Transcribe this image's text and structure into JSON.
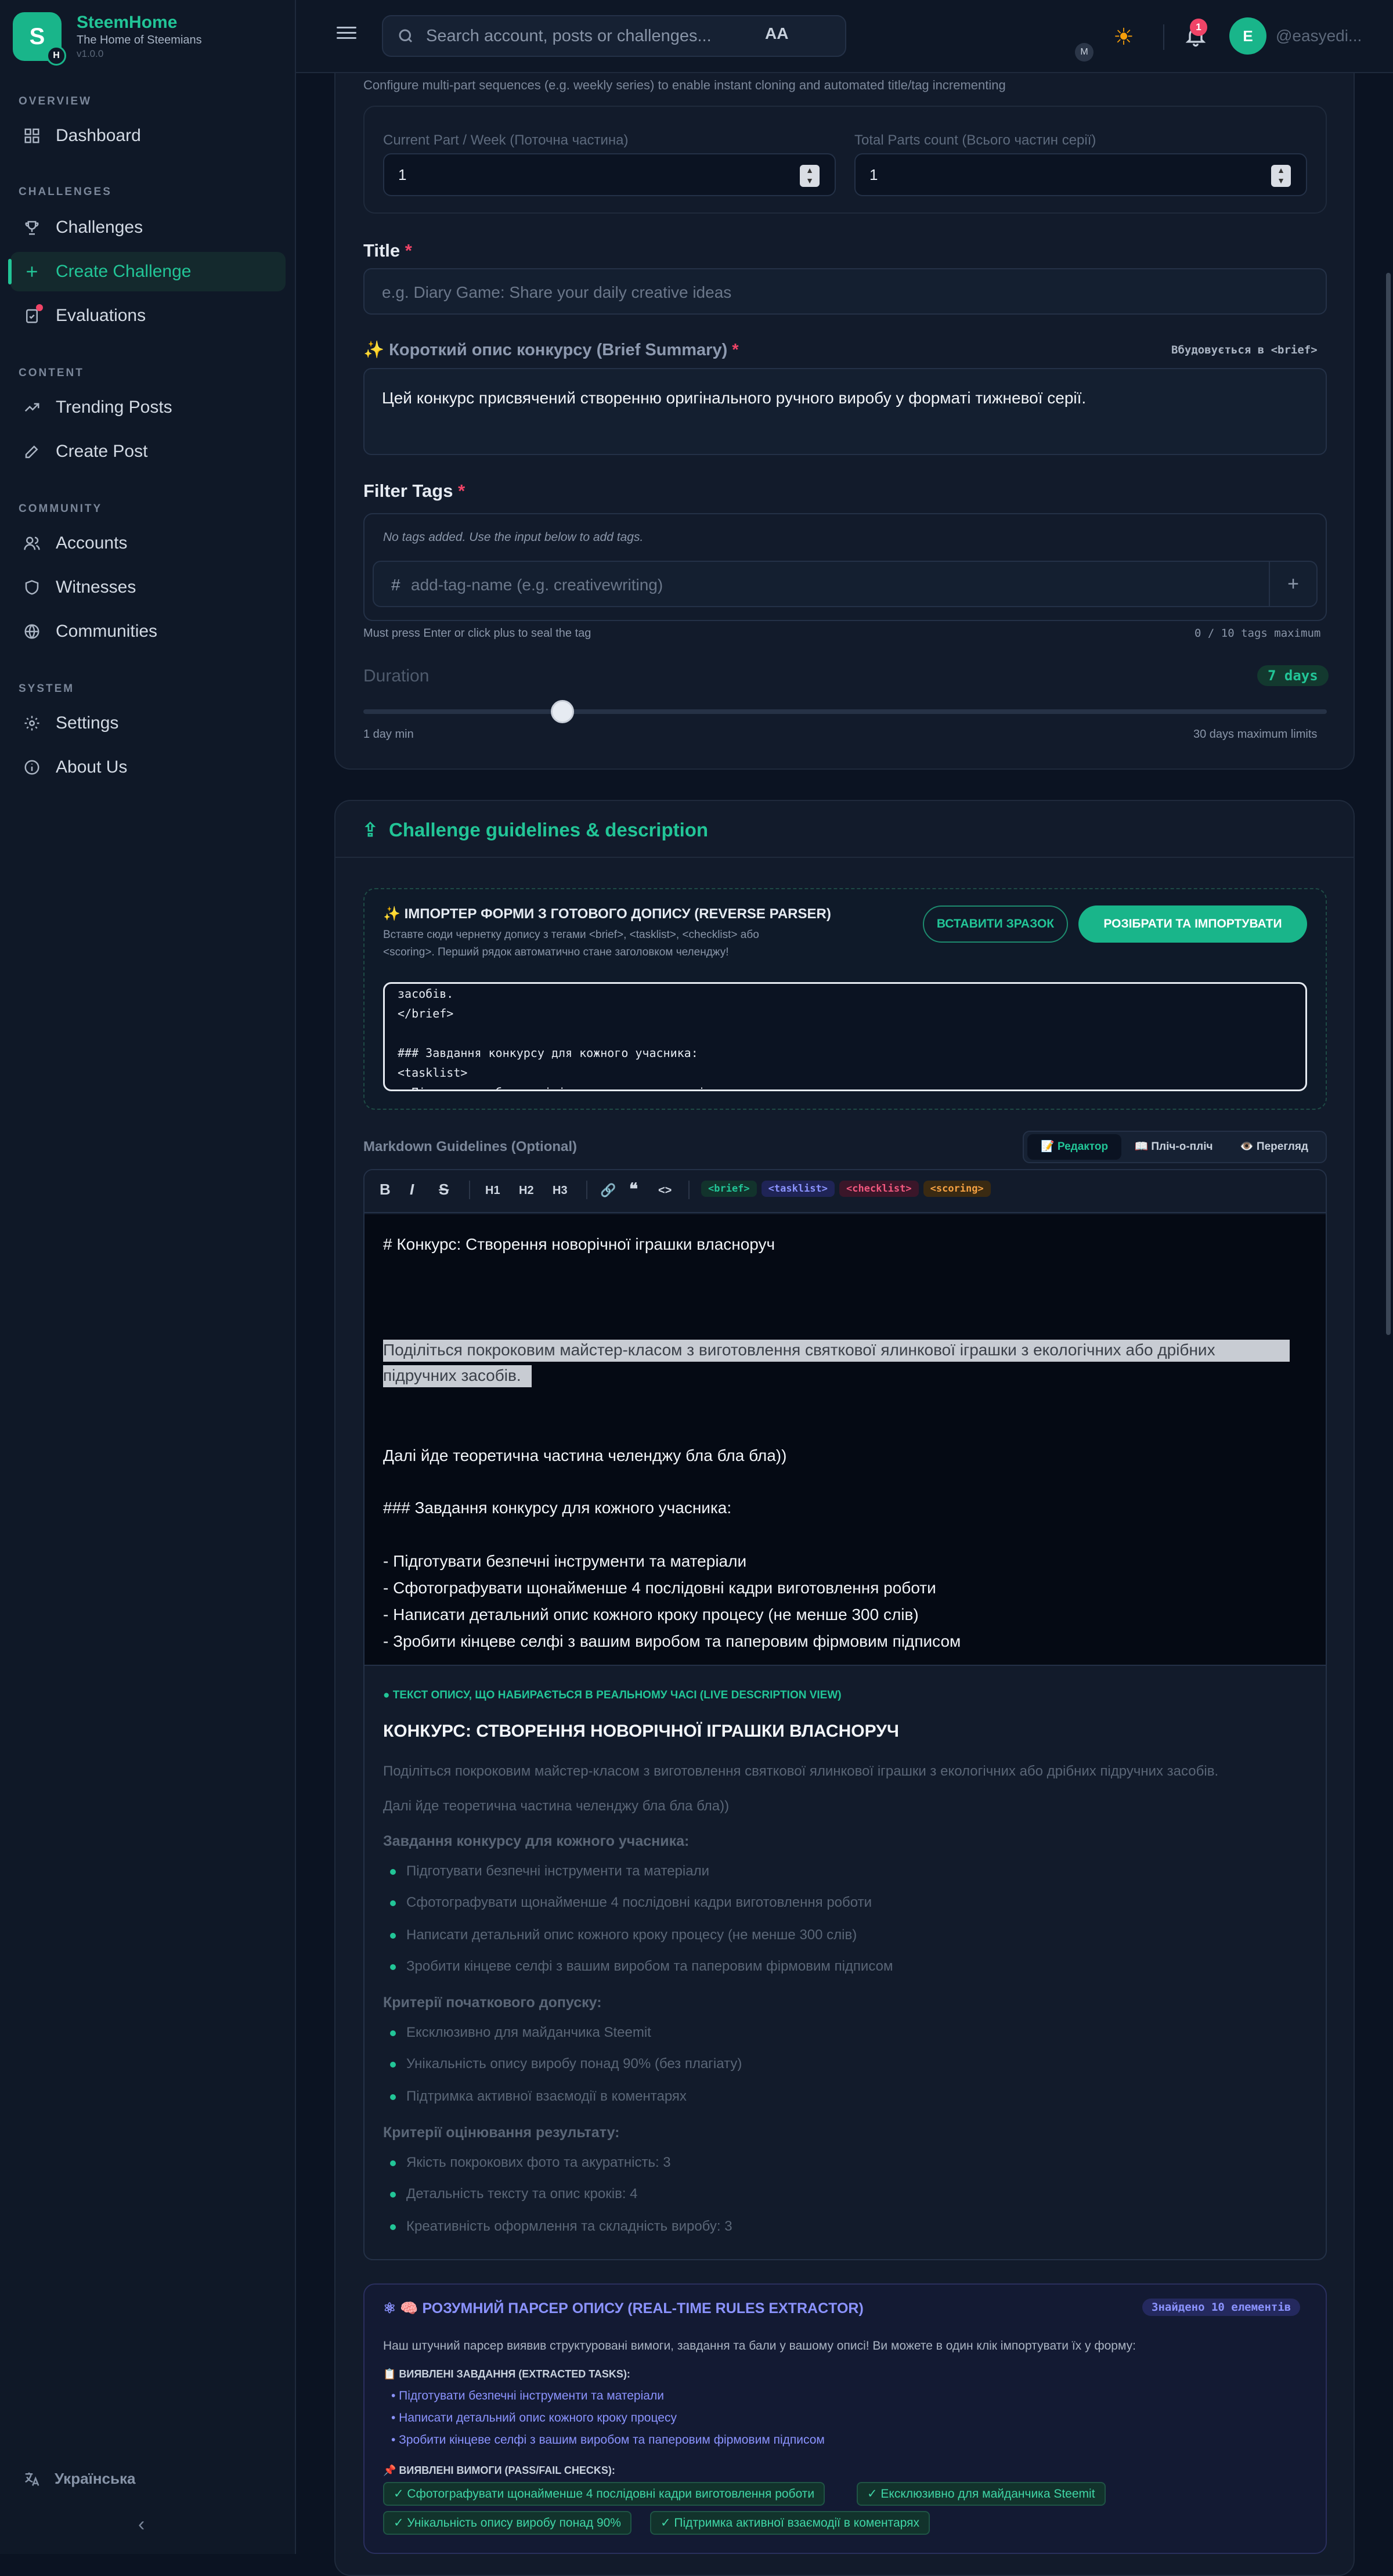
{
  "app": {
    "name": "SteemHome",
    "subtitle": "The Home of Steemians",
    "version": "v1.0.0",
    "logo_letter": "S",
    "logo_badge": "H"
  },
  "sidebar": {
    "sections": [
      {
        "label": "OVERVIEW",
        "items": [
          {
            "label": "Dashboard",
            "icon": "grid-icon"
          }
        ]
      },
      {
        "label": "CHALLENGES",
        "items": [
          {
            "label": "Challenges",
            "icon": "trophy-icon"
          },
          {
            "label": "Create Challenge",
            "icon": "plus-icon"
          },
          {
            "label": "Evaluations",
            "icon": "clipboard-check-icon"
          }
        ]
      },
      {
        "label": "CONTENT",
        "items": [
          {
            "label": "Trending Posts",
            "icon": "trending-up-icon"
          },
          {
            "label": "Create Post",
            "icon": "edit-icon"
          }
        ]
      },
      {
        "label": "COMMUNITY",
        "items": [
          {
            "label": "Accounts",
            "icon": "users-icon"
          },
          {
            "label": "Witnesses",
            "icon": "shield-icon"
          },
          {
            "label": "Communities",
            "icon": "globe-icon"
          }
        ]
      },
      {
        "label": "SYSTEM",
        "items": [
          {
            "label": "Settings",
            "icon": "gear-icon"
          },
          {
            "label": "About Us",
            "icon": "info-icon"
          }
        ]
      }
    ],
    "language": "Українська",
    "collapse": "‹"
  },
  "topbar": {
    "search_placeholder": "Search account, posts or challenges...",
    "font_size": "AA",
    "font_size_badge": "M",
    "notifications": "1",
    "avatar_letter": "E",
    "username": "@easyedi..."
  },
  "series": {
    "hint": "Configure multi-part sequences (e.g. weekly series) to enable instant cloning and automated title/tag incrementing",
    "current_label": "Current Part / Week (Поточна частина)",
    "current_value": "1",
    "total_label": "Total Parts count (Всього частин серії)",
    "total_value": "1"
  },
  "title_field": {
    "label": "Title",
    "placeholder": "e.g. Diary Game: Share your daily creative ideas"
  },
  "brief": {
    "label": "Короткий опис конкурсу (Brief Summary)",
    "embed_note": "Вбудовується в <brief>",
    "value": "Цей конкурс присвячений створенню оригінального ручного виробу у форматі тижневої серії."
  },
  "tags": {
    "label": "Filter Tags",
    "empty": "No tags added. Use the input below to add tags.",
    "placeholder": "add-tag-name (e.g. creativewriting)",
    "hint": "Must press Enter or click plus to seal the tag",
    "count": "0 / 10 tags maximum"
  },
  "duration": {
    "label": "Duration",
    "value_label": "7 days",
    "value": 7,
    "min": 1,
    "max": 30,
    "min_label": "1 day min",
    "max_label": "30 days maximum limits"
  },
  "guidelines": {
    "header": "Challenge guidelines & description",
    "importer_title": "ІМПОРТЕР ФОРМИ З ГОТОВОГО ДОПИСУ (REVERSE PARSER)",
    "importer_desc_1": "Вставте сюди чернетку допису з тегами <brief>, <tasklist>, <checklist> або",
    "importer_desc_2": "<scoring>. Перший рядок автоматично стане заголовком челенджу!",
    "btn_sample": "ВСТАВИТИ ЗРАЗОК",
    "btn_import": "РОЗІБРАТИ ТА ІМПОРТУВАТИ",
    "importer_lines": [
      "засобів.",
      "</brief>",
      "",
      "### Завдання конкурсу для кожного учасника:",
      "<tasklist>",
      "- Підготувати безпечні інструменти та матеріали"
    ],
    "md_label": "Markdown Guidelines (Optional)",
    "tabs": [
      "📝 Редактор",
      "📖 Пліч-о-пліч",
      "👁️ Перегляд"
    ],
    "toolbar": {
      "bold": "B",
      "italic": "I",
      "strike": "S",
      "h1": "H1",
      "h2": "H2",
      "h3": "H3",
      "link": "🔗",
      "quote": "❝",
      "code": "<>"
    },
    "chips": [
      "<brief>",
      "<tasklist>",
      "<checklist>",
      "<scoring>"
    ],
    "editor_lines": {
      "l1": "# Конкурс: Створення новорічної іграшки власноруч",
      "l2a": "Поділіться покроковим майстер-класом з виготовлення святкової ялинкової іграшки з екологічних або дрібних",
      "l2b": "підручних засобів.",
      "l3": "Далі йде теоретична частина челенджу бла бла бла))",
      "l4": "### Завдання конкурсу для кожного учасника:",
      "l5": "- Підготувати безпечні інструменти та матеріали",
      "l6": "- Сфотографувати щонайменше 4 послідовні кадри виготовлення роботи",
      "l7": "- Написати детальний опис кожного кроку процесу (не менше 300 слів)",
      "l8": "- Зробити кінцеве селфі з вашим виробом та паперовим фірмовим підписом"
    }
  },
  "live": {
    "label": "● ТЕКСТ ОПИСУ, ЩО НАБИРАЄТЬСЯ В РЕАЛЬНОМУ ЧАСІ (LIVE DESCRIPTION VIEW)",
    "title": "КОНКУРС: СТВОРЕННЯ НОВОРІЧНОЇ ІГРАШКИ ВЛАСНОРУЧ",
    "p1": "Поділіться покроковим майстер-класом з виготовлення святкової ялинкової іграшки з екологічних або дрібних підручних засобів.",
    "p2": "Далі йде теоретична частина челенджу бла бла бла))",
    "tasks_head": "Завдання конкурсу для кожного учасника:",
    "tasks": [
      "Підготувати безпечні інструменти та матеріали",
      "Сфотографувати щонайменше 4 послідовні кадри виготовлення роботи",
      "Написати детальний опис кожного кроку процесу (не менше 300 слів)",
      "Зробити кінцеве селфі з вашим виробом та паперовим фірмовим підписом"
    ],
    "check_head": "Критерії початкового допуску:",
    "checks": [
      "Ексклюзивно для майданчика Steemit",
      "Унікальність опису виробу понад 90% (без плагіату)",
      "Підтримка активної взаємодії в коментарях"
    ],
    "score_head": "Критерії оцінювання результату:",
    "scores": [
      "Якість покрокових фото та акуратність: 3",
      "Детальність тексту та опис кроків: 4",
      "Креативність оформлення та складність виробу: 3"
    ]
  },
  "parser": {
    "title": "🧠 РОЗУМНИЙ ПАРСЕР ОПИСУ (REAL-TIME RULES EXTRACTOR)",
    "found": "Знайдено 10 елементів",
    "desc": "Наш штучний парсер виявив структуровані вимоги, завдання та бали у вашому описі! Ви можете в один клік імпортувати їх у форму:",
    "tasks_head": "📋 ВИЯВЛЕНІ ЗАВДАННЯ (EXTRACTED TASKS):",
    "tasks": [
      "• Підготувати безпечні інструменти та матеріали",
      "• Написати детальний опис кожного кроку процесу",
      "• Зробити кінцеве селфі з вашим виробом та паперовим фірмовим підписом"
    ],
    "req_head": "📌 ВИЯВЛЕНІ ВИМОГИ (PASS/FAIL CHECKS):",
    "reqs": [
      "✓ Сфотографувати щонайменше 4 послідовні кадри виготовлення роботи",
      "✓ Ексклюзивно для майданчика Steemit",
      "✓ Унікальність опису виробу понад 90%",
      "✓ Підтримка активної взаємодії в коментарях"
    ]
  },
  "colors": {
    "accent": "#22c597",
    "bg": "#0b1322",
    "card": "#121b2b",
    "danger": "#f04467"
  }
}
